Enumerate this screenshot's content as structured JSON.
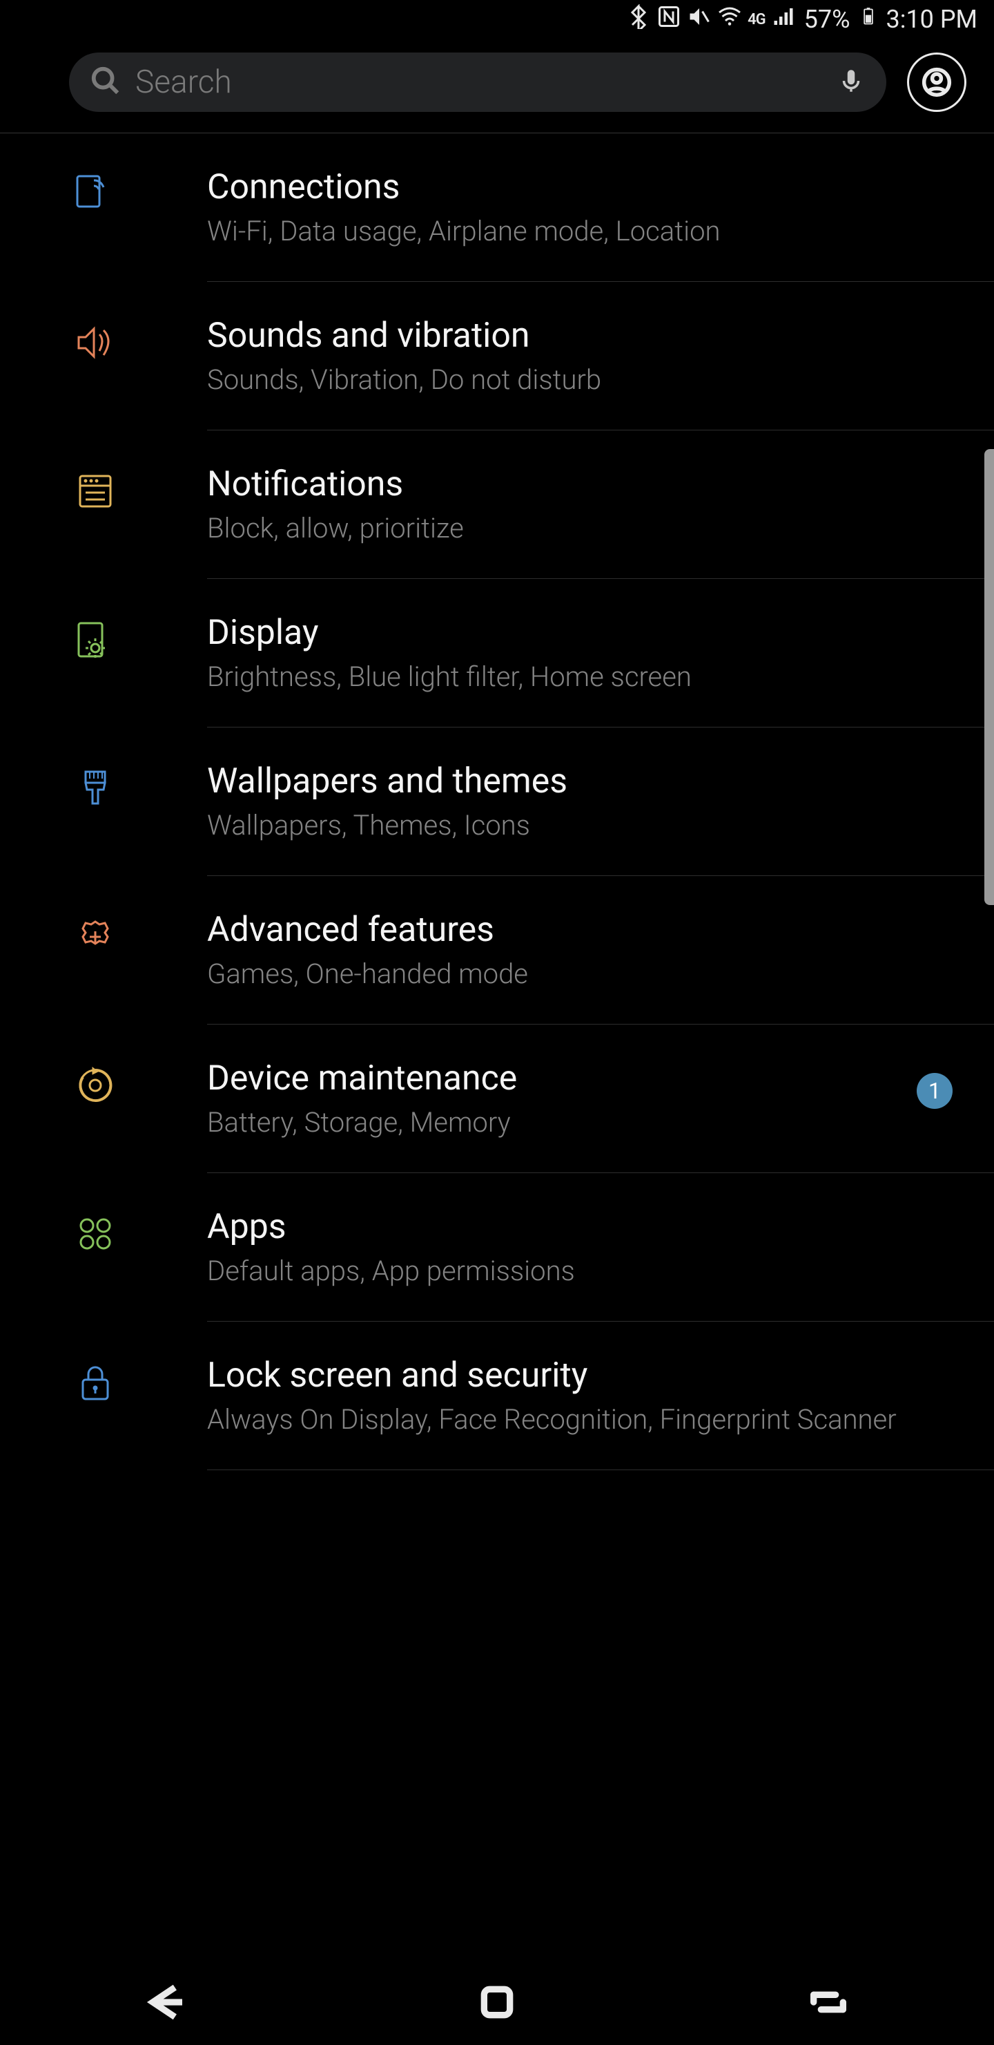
{
  "status": {
    "battery_pct": "57%",
    "time": "3:10 PM",
    "network_label": "4G",
    "icons": [
      "bluetooth",
      "nfc",
      "mute",
      "wifi",
      "4g",
      "signal",
      "battery"
    ]
  },
  "search": {
    "placeholder": "Search"
  },
  "settings": [
    {
      "id": "connections",
      "icon": "connections-icon",
      "icon_color": "#4d8fd6",
      "title": "Connections",
      "sub": "Wi-Fi, Data usage, Airplane mode, Location",
      "badge": null
    },
    {
      "id": "sounds-vibration",
      "icon": "sound-icon",
      "icon_color": "#e4835a",
      "title": "Sounds and vibration",
      "sub": "Sounds, Vibration, Do not disturb",
      "badge": null
    },
    {
      "id": "notifications",
      "icon": "notifications-icon",
      "icon_color": "#e0b45a",
      "title": "Notifications",
      "sub": "Block, allow, prioritize",
      "badge": null
    },
    {
      "id": "display",
      "icon": "display-icon",
      "icon_color": "#86c15b",
      "title": "Display",
      "sub": "Brightness, Blue light filter, Home screen",
      "badge": null
    },
    {
      "id": "wallpapers-themes",
      "icon": "brush-icon",
      "icon_color": "#4d8fd6",
      "title": "Wallpapers and themes",
      "sub": "Wallpapers, Themes, Icons",
      "badge": null
    },
    {
      "id": "advanced-features",
      "icon": "gear-plus-icon",
      "icon_color": "#e4835a",
      "title": "Advanced features",
      "sub": "Games, One-handed mode",
      "badge": null
    },
    {
      "id": "device-maintenance",
      "icon": "cycle-icon",
      "icon_color": "#e0b45a",
      "title": "Device maintenance",
      "sub": "Battery, Storage, Memory",
      "badge": "1"
    },
    {
      "id": "apps",
      "icon": "apps-icon",
      "icon_color": "#86c15b",
      "title": "Apps",
      "sub": "Default apps, App permissions",
      "badge": null
    },
    {
      "id": "lock-security",
      "icon": "lock-icon",
      "icon_color": "#4d8fd6",
      "title": "Lock screen and security",
      "sub": "Always On Display, Face Recognition, Fingerprint Scanner",
      "badge": null
    }
  ],
  "colors": {
    "badge_bg": "#4b8cb5"
  }
}
